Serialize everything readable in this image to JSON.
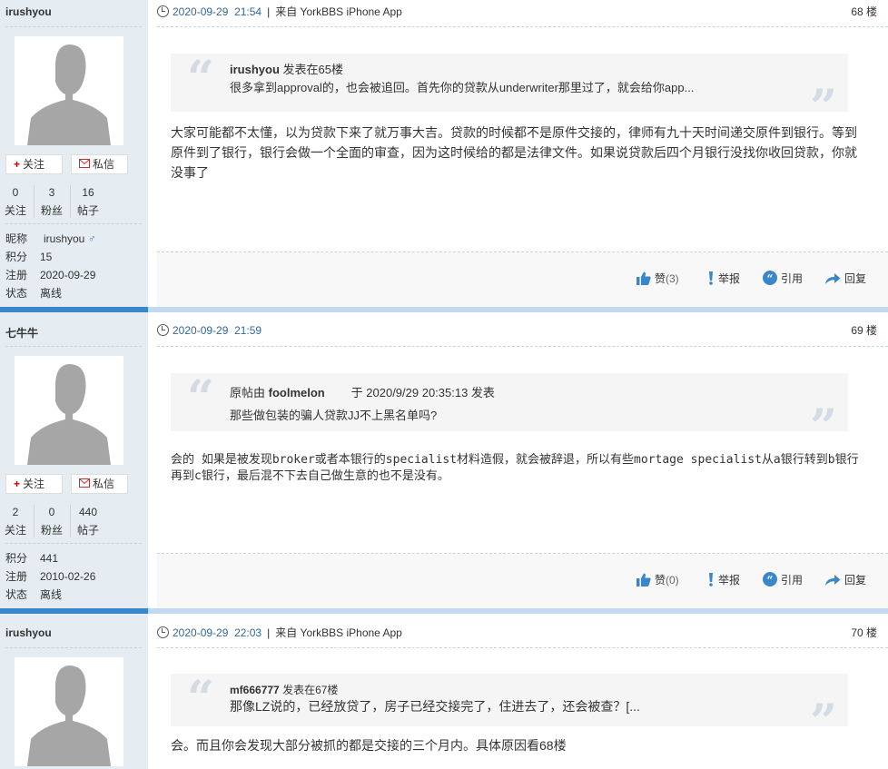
{
  "buttons": {
    "follow": "关注",
    "message": "私信"
  },
  "stat_labels": [
    "关注",
    "粉丝",
    "帖子"
  ],
  "info_labels": {
    "nickname": "昵称",
    "points": "积分",
    "register": "注册",
    "status": "状态"
  },
  "action_labels": {
    "like": "赞",
    "report": "举报",
    "quote": "引用",
    "reply": "回复"
  },
  "colors": {
    "sidebar": "#e5edf2",
    "accent": "#3b86c8",
    "date": "#336699",
    "follow_plus": "#d00000"
  },
  "posts": [
    {
      "author": "irushyou",
      "gender": "♂",
      "stats": [
        "0",
        "3",
        "16"
      ],
      "info": {
        "nickname": "irushyou",
        "points": "15",
        "register": "2020-09-29",
        "status": "离线"
      },
      "date": "2020-09-29",
      "time": "21:54",
      "source": "来自 YorkBBS iPhone App",
      "floor": "68 楼",
      "quote_user": "irushyou",
      "quote_suffix": "发表在65楼",
      "quote_text": "很多拿到approval的，也会被追回。首先你的贷款从underwriter那里过了，就会给你app...",
      "body": "大家可能都不太懂，以为贷款下来了就万事大吉。贷款的时候都不是原件交接的，律师有九十天时间递交原件到银行。等到原件到了银行，银行会做一个全面的审查，因为这时候给的都是法律文件。如果说贷款后四个月银行没找你收回贷款，你就没事了",
      "likes": "(3)"
    },
    {
      "author": "七牛牛",
      "stats": [
        "2",
        "0",
        "440"
      ],
      "info": {
        "points": "441",
        "register": "2010-02-26",
        "status": "离线"
      },
      "date": "2020-09-29",
      "time": "21:59",
      "floor": "69 楼",
      "quote_prefix": "原帖由",
      "quote_user": "foolmelon",
      "quote_suffix": "于 2020/9/29 20:35:13 发表",
      "quote_text": "那些做包装的骗人贷款JJ不上黑名单吗?",
      "body": "会的 如果是被发现broker或者本银行的specialist材料造假，就会被辞退，所以有些mortage specialist从a银行转到b银行再到c银行，最后混不下去自己做生意的也不是没有。",
      "likes": "(0)"
    },
    {
      "author": "irushyou",
      "date": "2020-09-29",
      "time": "22:03",
      "source": "来自 YorkBBS iPhone App",
      "floor": "70 楼",
      "quote_user": "mf666777",
      "quote_suffix": "发表在67楼",
      "quote_text": "那像LZ说的，已经放贷了，房子已经交接完了，住进去了，还会被查？[...",
      "body": "会。而且你会发现大部分被抓的都是交接的三个月内。具体原因看68楼"
    }
  ]
}
